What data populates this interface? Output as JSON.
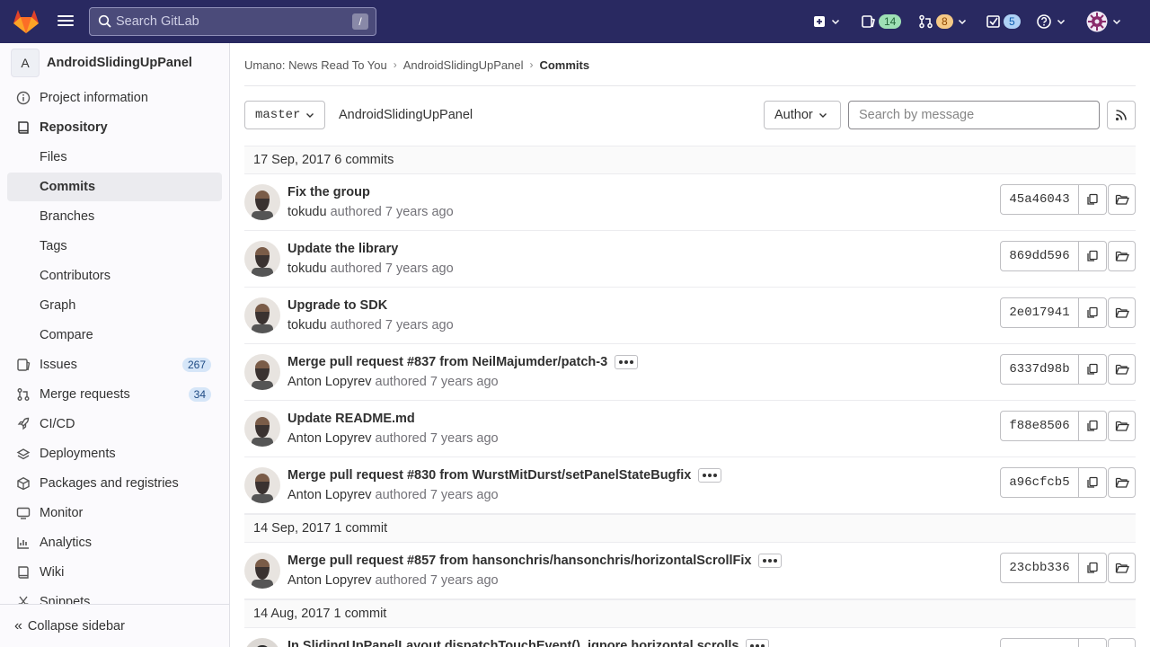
{
  "topbar": {
    "search_placeholder": "Search GitLab",
    "search_shortcut": "/",
    "issues_count": "14",
    "mr_count": "8",
    "todos_count": "5"
  },
  "sidebar": {
    "project_initial": "A",
    "project_name": "AndroidSlidingUpPanel",
    "items": [
      {
        "label": "Project information",
        "icon": "info-icon"
      },
      {
        "label": "Repository",
        "icon": "book-icon"
      },
      {
        "label": "Files"
      },
      {
        "label": "Commits"
      },
      {
        "label": "Branches"
      },
      {
        "label": "Tags"
      },
      {
        "label": "Contributors"
      },
      {
        "label": "Graph"
      },
      {
        "label": "Compare"
      },
      {
        "label": "Issues",
        "icon": "issues-icon",
        "count": "267"
      },
      {
        "label": "Merge requests",
        "icon": "merge-request-icon",
        "count": "34"
      },
      {
        "label": "CI/CD",
        "icon": "rocket-icon"
      },
      {
        "label": "Deployments",
        "icon": "deployments-icon"
      },
      {
        "label": "Packages and registries",
        "icon": "package-icon"
      },
      {
        "label": "Monitor",
        "icon": "monitor-icon"
      },
      {
        "label": "Analytics",
        "icon": "chart-icon"
      },
      {
        "label": "Wiki",
        "icon": "book-icon"
      },
      {
        "label": "Snippets",
        "icon": "snippet-icon"
      }
    ],
    "collapse_label": "Collapse sidebar"
  },
  "breadcrumb": {
    "group": "Umano: News Read To You",
    "project": "AndroidSlidingUpPanel",
    "current": "Commits"
  },
  "toolbar": {
    "branch": "master",
    "repo_path": "AndroidSlidingUpPanel",
    "author_label": "Author",
    "search_placeholder": "Search by message"
  },
  "days": [
    {
      "header": "17 Sep, 2017 6 commits"
    },
    {
      "header": "14 Sep, 2017 1 commit"
    },
    {
      "header": "14 Aug, 2017 1 commit"
    }
  ],
  "commits": [
    {
      "title": "Fix the group",
      "author": "tokudu",
      "authored": "authored",
      "time": "7 years ago",
      "sha": "45a46043",
      "has_more": false
    },
    {
      "title": "Update the library",
      "author": "tokudu",
      "authored": "authored",
      "time": "7 years ago",
      "sha": "869dd596",
      "has_more": false
    },
    {
      "title": "Upgrade to SDK",
      "author": "tokudu",
      "authored": "authored",
      "time": "7 years ago",
      "sha": "2e017941",
      "has_more": false
    },
    {
      "title": "Merge pull request #837 from NeilMajumder/patch-3",
      "author": "Anton Lopyrev",
      "authored": "authored",
      "time": "7 years ago",
      "sha": "6337d98b",
      "has_more": true
    },
    {
      "title": "Update README.md",
      "author": "Anton Lopyrev",
      "authored": "authored",
      "time": "7 years ago",
      "sha": "f88e8506",
      "has_more": false
    },
    {
      "title": "Merge pull request #830 from WurstMitDurst/setPanelStateBugfix",
      "author": "Anton Lopyrev",
      "authored": "authored",
      "time": "7 years ago",
      "sha": "a96cfcb5",
      "has_more": true
    },
    {
      "title": "Merge pull request #857 from hansonchris/hansonchris/horizontalScrollFix",
      "author": "Anton Lopyrev",
      "authored": "authored",
      "time": "7 years ago",
      "sha": "23cbb336",
      "has_more": true
    },
    {
      "title": "In SlidingUpPanelLayout.dispatchTouchEvent(), ignore horizontal scrolls",
      "author": "",
      "authored": "",
      "time": "",
      "sha": "",
      "has_more": true
    }
  ]
}
